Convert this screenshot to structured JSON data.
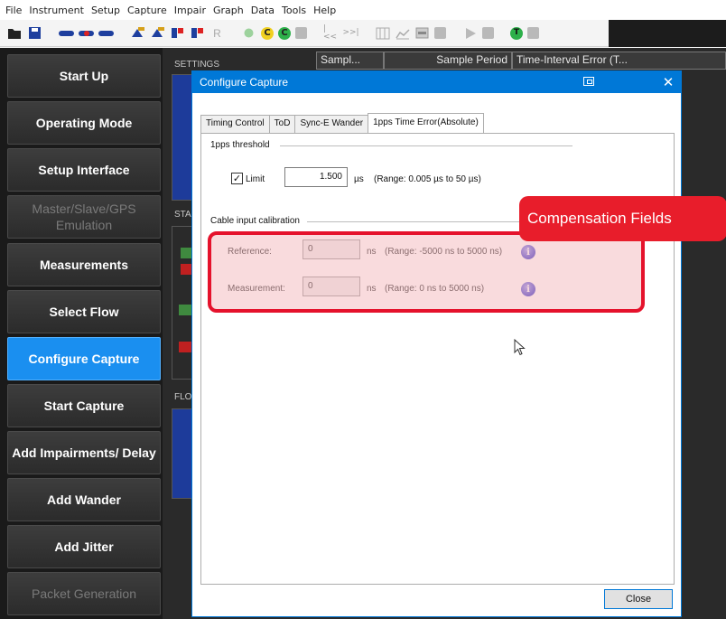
{
  "menubar": {
    "items": [
      "File",
      "Instrument",
      "Setup",
      "Capture",
      "Impair",
      "Graph",
      "Data",
      "Tools",
      "Help"
    ]
  },
  "toolbar": {
    "icons": [
      "open-folder-icon",
      "save-icon",
      "link-icon",
      "link-icon",
      "link-icon",
      "capture-icon",
      "capture-icon",
      "capture-icon",
      "capture-icon",
      "r-icon",
      "leaf-icon",
      "c-icon",
      "c-green-icon",
      "stop-icon",
      "rewind-icon",
      "forward-icon",
      "grid-icon",
      "chart-icon",
      "panel-icon",
      "square-icon",
      "play-icon",
      "stop-icon",
      "t-icon",
      "square-icon"
    ],
    "r_glyph": "R",
    "rewind_glyph": "|<<",
    "forward_glyph": ">>|"
  },
  "leftnav": {
    "items": [
      {
        "label": "Start Up",
        "state": "normal"
      },
      {
        "label": "Operating Mode",
        "state": "normal"
      },
      {
        "label": "Setup Interface",
        "state": "normal"
      },
      {
        "label": "Master/Slave/GPS Emulation",
        "state": "disabled"
      },
      {
        "label": "Measurements",
        "state": "normal"
      },
      {
        "label": "Select Flow",
        "state": "normal"
      },
      {
        "label": "Configure Capture",
        "state": "active"
      },
      {
        "label": "Start Capture",
        "state": "normal"
      },
      {
        "label": "Add Impairments/ Delay",
        "state": "normal"
      },
      {
        "label": "Add Wander",
        "state": "normal"
      },
      {
        "label": "Add Jitter",
        "state": "normal"
      },
      {
        "label": "Packet Generation",
        "state": "disabled"
      }
    ]
  },
  "background": {
    "settings_label": "SETTINGS",
    "st_label": "STA",
    "fl_label": "FLO",
    "columns": [
      "Sampl...",
      "Sample Period",
      "Time-Interval Error (T..."
    ]
  },
  "dialog": {
    "title": "Configure Capture",
    "tabs": [
      {
        "label": "Timing Control",
        "selected": false
      },
      {
        "label": "ToD",
        "selected": false
      },
      {
        "label": "Sync-E Wander",
        "selected": false
      },
      {
        "label": "1pps Time Error(Absolute)",
        "selected": true
      }
    ],
    "threshold": {
      "group_title": "1pps threshold",
      "limit_label": "Limit",
      "limit_checked": true,
      "limit_value": "1.500",
      "limit_unit": "µs",
      "limit_range": "(Range: 0.005 µs to 50 µs)"
    },
    "calibration": {
      "group_title": "Cable input calibration",
      "reference_label": "Reference:",
      "reference_value": "0",
      "reference_unit": "ns",
      "reference_range": "(Range: -5000 ns to 5000 ns)",
      "measurement_label": "Measurement:",
      "measurement_value": "0",
      "measurement_unit": "ns",
      "measurement_range": "(Range: 0 ns to 5000 ns)"
    },
    "close_label": "Close"
  },
  "annotation": {
    "callout_text": "Compensation Fields",
    "color": "#e81d2b"
  },
  "colors": {
    "accent": "#0078d7",
    "nav_active": "#1a8ff0",
    "nav_bg": "#1a1a1a"
  }
}
